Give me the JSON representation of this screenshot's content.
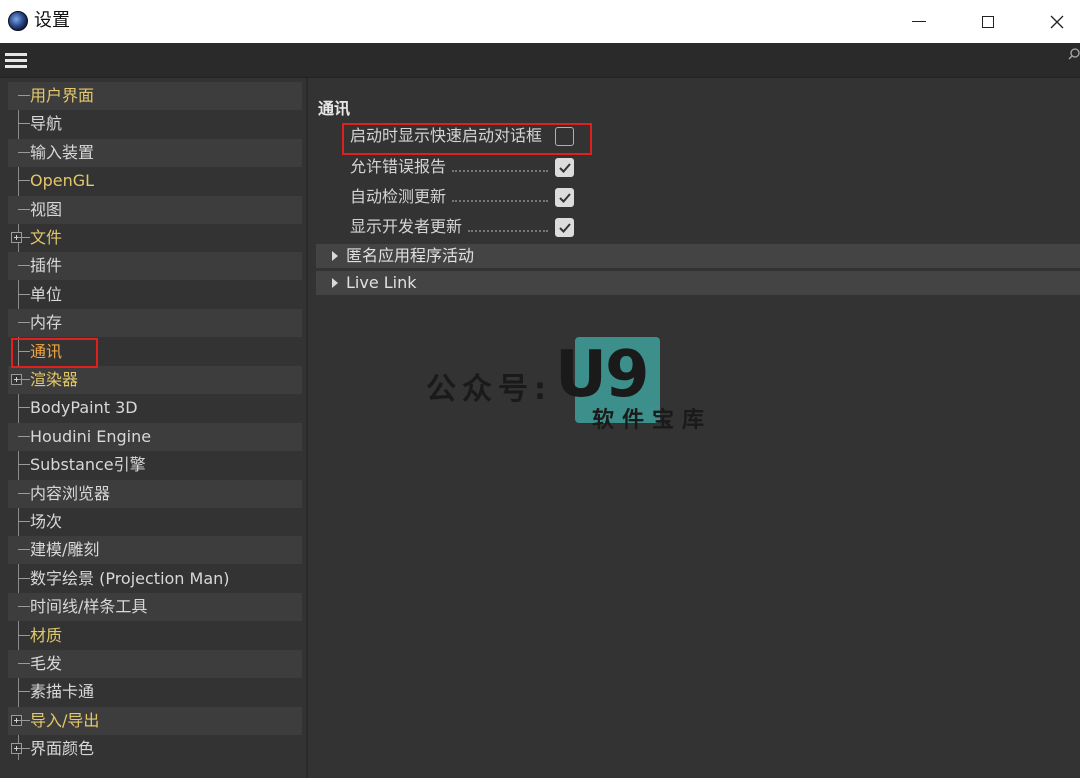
{
  "window": {
    "title": "设置"
  },
  "tree": [
    {
      "label": "用户界面",
      "color": "yellow",
      "expandable": false
    },
    {
      "label": "导航",
      "color": "normal",
      "expandable": false
    },
    {
      "label": "输入装置",
      "color": "normal",
      "expandable": false
    },
    {
      "label": "OpenGL",
      "color": "yellow",
      "expandable": false
    },
    {
      "label": "视图",
      "color": "normal",
      "expandable": false
    },
    {
      "label": "文件",
      "color": "yellow",
      "expandable": true
    },
    {
      "label": "插件",
      "color": "normal",
      "expandable": false
    },
    {
      "label": "单位",
      "color": "normal",
      "expandable": false
    },
    {
      "label": "内存",
      "color": "normal",
      "expandable": false
    },
    {
      "label": "通讯",
      "color": "orange",
      "expandable": false,
      "selected": true
    },
    {
      "label": "渲染器",
      "color": "yellow",
      "expandable": true
    },
    {
      "label": "BodyPaint 3D",
      "color": "normal",
      "expandable": false
    },
    {
      "label": "Houdini Engine",
      "color": "normal",
      "expandable": false
    },
    {
      "label": "Substance引擎",
      "color": "normal",
      "expandable": false
    },
    {
      "label": "内容浏览器",
      "color": "normal",
      "expandable": false
    },
    {
      "label": "场次",
      "color": "normal",
      "expandable": false
    },
    {
      "label": "建模/雕刻",
      "color": "normal",
      "expandable": false
    },
    {
      "label": "数字绘景 (Projection Man)",
      "color": "normal",
      "expandable": false
    },
    {
      "label": "时间线/样条工具",
      "color": "normal",
      "expandable": false
    },
    {
      "label": "材质",
      "color": "yellow",
      "expandable": false
    },
    {
      "label": "毛发",
      "color": "normal",
      "expandable": false
    },
    {
      "label": "素描卡通",
      "color": "normal",
      "expandable": false
    },
    {
      "label": "导入/导出",
      "color": "yellow",
      "expandable": true
    },
    {
      "label": "界面颜色",
      "color": "normal",
      "expandable": true
    }
  ],
  "panel": {
    "section_title": "通讯",
    "options": [
      {
        "label": "启动时显示快速启动对话框",
        "checked": false
      },
      {
        "label": "允许错误报告",
        "checked": true
      },
      {
        "label": "自动检测更新",
        "checked": true
      },
      {
        "label": "显示开发者更新",
        "checked": true
      }
    ],
    "groups": [
      {
        "label": "匿名应用程序活动"
      },
      {
        "label": "Live Link"
      }
    ]
  },
  "watermark": {
    "text": "公众号:",
    "logo": "U9",
    "sub": "软件宝库"
  },
  "colors": {
    "highlight": "#e01f1f",
    "yellow_label": "#e2c86a",
    "selected_label": "#f0a640"
  }
}
